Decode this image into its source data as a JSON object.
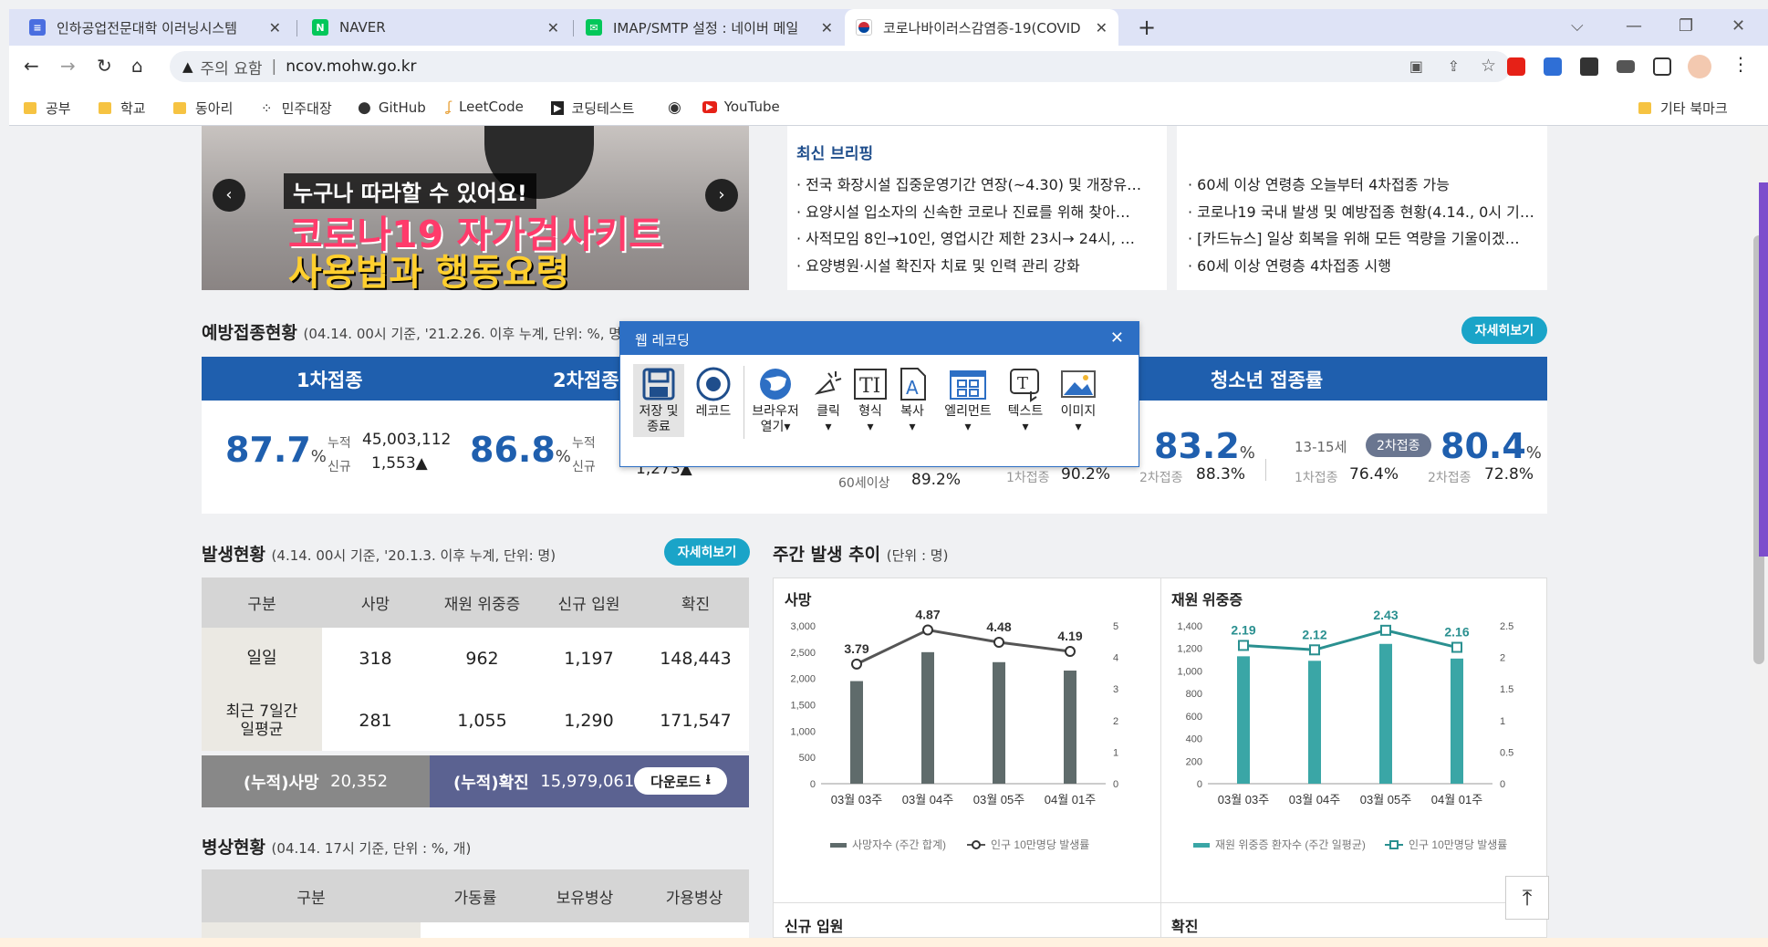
{
  "browser": {
    "tabs": [
      {
        "title": "인하공업전문대학 이러닝시스템",
        "icon": "document-icon",
        "color": "#4a6ee0"
      },
      {
        "title": "NAVER",
        "icon": "naver-icon",
        "color": "#03c75a"
      },
      {
        "title": "IMAP/SMTP 설정 : 네이버 메일",
        "icon": "mail-icon",
        "color": "#03c75a"
      },
      {
        "title": "코로나바이러스감염증-19(COVID",
        "icon": "korea-flag-icon",
        "color": "#cd2e3a"
      }
    ],
    "new_tab": "+",
    "security_label": "주의 요함",
    "url": "ncov.mohw.go.kr",
    "bookmarks": [
      "공부",
      "학교",
      "동아리",
      "민주대장",
      "GitHub",
      "LeetCode",
      "코딩테스트",
      "",
      "YouTube"
    ],
    "other_bookmarks": "기타 북마크"
  },
  "banner": {
    "line1": "누구나 따라할 수 있어요!",
    "line2": "코로나19 자가검사키트",
    "line3": "사용법과 행동요령"
  },
  "briefing": {
    "title": "최신 브리핑",
    "items": [
      "· 전국 화장시설 집중운영기간 연장(~4.30) 및 개장유…",
      "· 요양시설 입소자의 신속한 코로나 진료를 위해 찾아…",
      "· 사적모임 8인→10인, 영업시간 제한 23시→ 24시, …",
      "· 요양병원·시설 확진자 치료 및 인력 관리 강화"
    ]
  },
  "news2": {
    "items": [
      "· 60세 이상 연령층 오늘부터 4차접종 가능",
      "· 코로나19 국내 발생 및 예방접종 현황(4.14., 0시 기…",
      "· [카드뉴스] 일상 회복을 위해 모든 역량을 기울이겠…",
      "· 60세 이상 연령층 4차접종 시행"
    ]
  },
  "vaccination": {
    "title": "예방접종현황",
    "subtitle": "(04.14. 00시 기준, '21.2.26. 이후 누계, 단위: %, 명)",
    "detail_btn": "자세히보기",
    "headers": [
      "1차접종",
      "2차접종",
      "청소년 접종률"
    ],
    "first": {
      "pct": "87.7",
      "cum_label": "누적",
      "cum": "45,003,112",
      "new_label": "신규",
      "new": "1,553▲"
    },
    "second": {
      "pct": "86.8",
      "cum_label": "누적",
      "new_label": "신규",
      "new": "1,273▲"
    },
    "age60": {
      "label": "60세이상",
      "value": "89.2%"
    },
    "teen_a": {
      "pct": "83.2",
      "l1": "1차접종",
      "v1": "90.2%",
      "l2": "2차접종",
      "v2": "88.3%"
    },
    "teen_b": {
      "age": "13-15세",
      "badge": "2차접종",
      "pct": "80.4",
      "l1": "1차접종",
      "v1": "76.4%",
      "l2": "2차접종",
      "v2": "72.8%"
    },
    "unit": "%"
  },
  "outbreak": {
    "title": "발생현황",
    "subtitle": "(4.14. 00시 기준, '20.1.3. 이후 누계, 단위: 명)",
    "detail_btn": "자세히보기",
    "columns": [
      "구분",
      "사망",
      "재원 위중증",
      "신규 입원",
      "확진"
    ],
    "rows": [
      {
        "label": "일일",
        "values": [
          "318",
          "962",
          "1,197",
          "148,443"
        ]
      },
      {
        "label": "최근 7일간\n일평균",
        "values": [
          "281",
          "1,055",
          "1,290",
          "171,547"
        ]
      }
    ],
    "cum_death_label": "(누적)사망",
    "cum_death": "20,352",
    "cum_conf_label": "(누적)확진",
    "cum_conf": "15,979,061",
    "download": "다운로드"
  },
  "beds": {
    "title": "병상현황",
    "subtitle": "(04.14. 17시 기준, 단위 : %, 개)",
    "columns": [
      "구분",
      "가동률",
      "보유병상",
      "가용병상"
    ]
  },
  "weekly": {
    "title": "주간 발생 추이",
    "subtitle": "(단위 : 명)",
    "next_titles": [
      "신규 입원",
      "확진"
    ]
  },
  "chart_data": [
    {
      "type": "bar",
      "title": "사망",
      "categories": [
        "03월 03주",
        "03월 04주",
        "03월 05주",
        "04월 01주"
      ],
      "series": [
        {
          "name": "사망자수 (주간 합계)",
          "values": [
            1950,
            2500,
            2310,
            2150
          ],
          "axis": "left",
          "color": "#5f6b6b"
        },
        {
          "name": "인구 10만명당 발생률",
          "values": [
            3.79,
            4.87,
            4.48,
            4.19
          ],
          "axis": "right",
          "type": "line",
          "color": "#555555"
        }
      ],
      "ylim": [
        0,
        3000
      ],
      "yticks": [
        "0",
        "500",
        "1,000",
        "1,500",
        "2,000",
        "2,500",
        "3,000"
      ],
      "y2lim": [
        0,
        5
      ],
      "y2ticks": [
        "0",
        "1",
        "2",
        "3",
        "4",
        "5"
      ],
      "legend": "bottom"
    },
    {
      "type": "bar",
      "title": "재원 위중증",
      "categories": [
        "03월 03주",
        "03월 04주",
        "03월 05주",
        "04월 01주"
      ],
      "series": [
        {
          "name": "재원 위중증 환자수 (주간 일평균)",
          "values": [
            1130,
            1090,
            1240,
            1110
          ],
          "axis": "left",
          "color": "#3aa6a6"
        },
        {
          "name": "인구 10만명당 발생률",
          "values": [
            2.19,
            2.12,
            2.43,
            2.16
          ],
          "axis": "right",
          "type": "line",
          "color": "#2a9090"
        }
      ],
      "ylim": [
        0,
        1400
      ],
      "yticks": [
        "0",
        "200",
        "400",
        "600",
        "800",
        "1,000",
        "1,200",
        "1,400"
      ],
      "y2lim": [
        0,
        2.5
      ],
      "y2ticks": [
        "0",
        "0.5",
        "1",
        "1.5",
        "2",
        "2.5"
      ],
      "legend": "bottom"
    }
  ],
  "recorder": {
    "title": "웹 레코딩",
    "tools": [
      {
        "label": "저장 및\n종료"
      },
      {
        "label": "레코드"
      },
      {
        "label": "브라우저\n열기▾"
      },
      {
        "label": "클릭\n▾"
      },
      {
        "label": "형식\n▾"
      },
      {
        "label": "복사\n▾"
      },
      {
        "label": "엘리먼트\n▾"
      },
      {
        "label": "텍스트\n▾"
      },
      {
        "label": "이미지\n▾"
      }
    ]
  }
}
